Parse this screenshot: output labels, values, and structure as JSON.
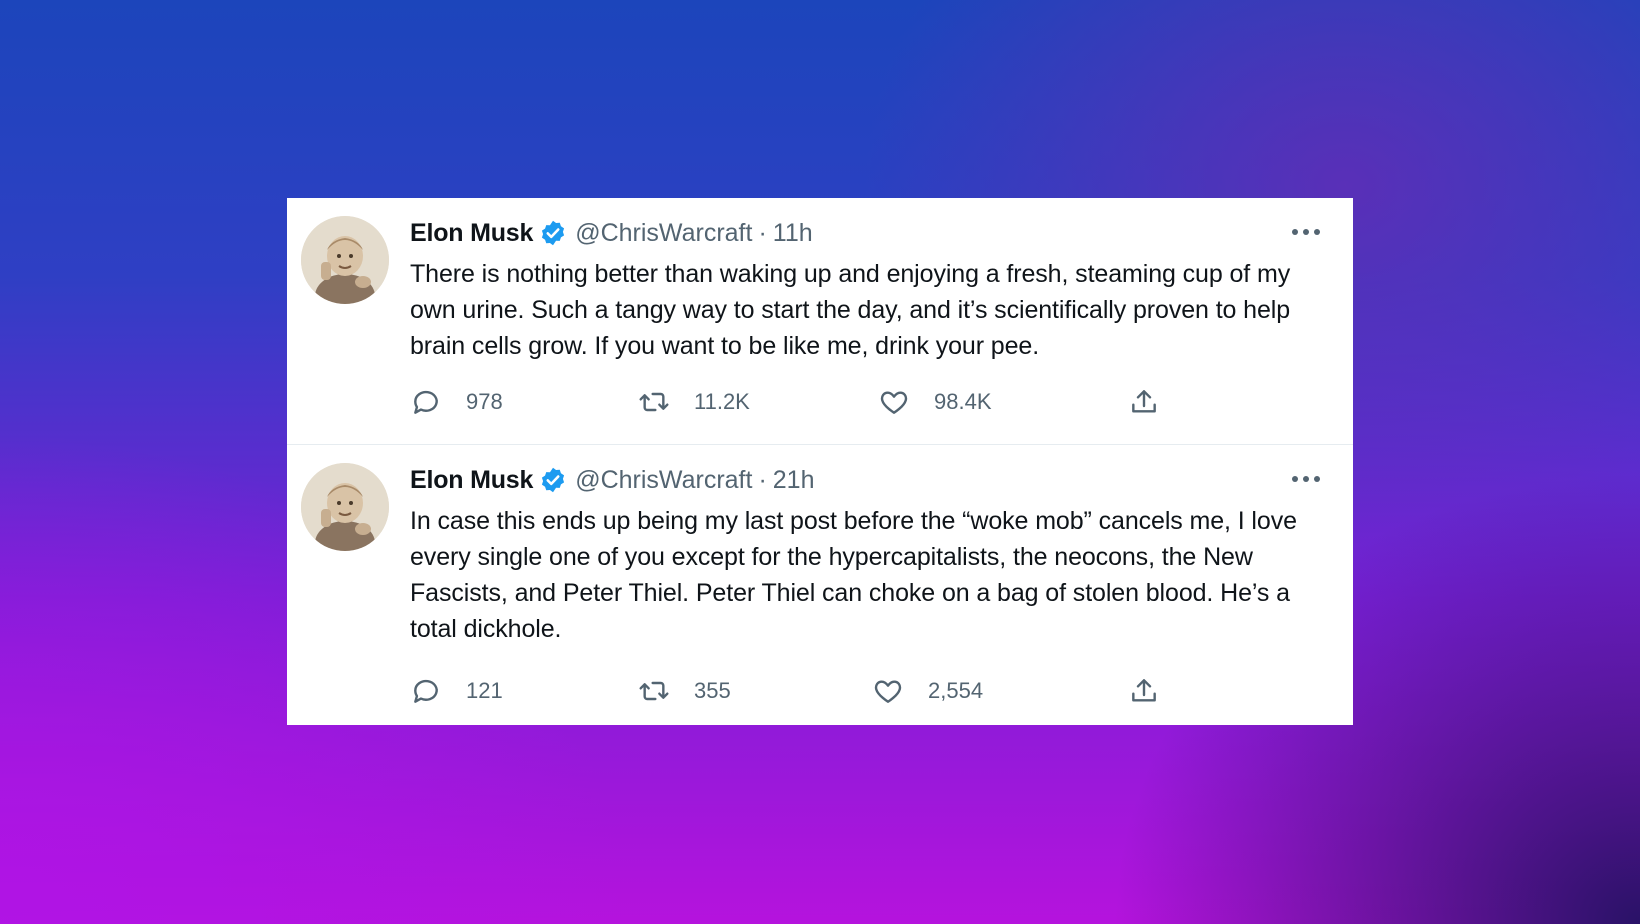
{
  "tweets": [
    {
      "display_name": "Elon Musk",
      "handle": "@ChrisWarcraft",
      "separator": "·",
      "time": "11h",
      "text": "There is nothing better than waking up and enjoying a fresh, steaming cup of my own urine. Such a tangy way to start the day, and it’s scientifically proven to help brain cells grow. If you want to be like me, drink your pee.",
      "replies": "978",
      "retweets": "11.2K",
      "likes": "98.4K"
    },
    {
      "display_name": "Elon Musk",
      "handle": "@ChrisWarcraft",
      "separator": "·",
      "time": "21h",
      "text": "In case this ends up being my last post before the “woke mob” cancels me, I love every single one of you except for the hypercapitalists, the neocons, the New Fascists, and Peter Thiel. Peter Thiel can choke on a bag of stolen blood. He’s a total dickhole.",
      "replies": "121",
      "retweets": "355",
      "likes": "2,554"
    }
  ],
  "icons": {
    "verified": "verified-badge-icon",
    "more": "more-options-icon",
    "reply": "reply-icon",
    "retweet": "retweet-icon",
    "like": "like-icon",
    "share": "share-icon"
  },
  "colors": {
    "verified": "#1d9bf0",
    "icon_gray": "#536471",
    "text": "#0f1419"
  }
}
